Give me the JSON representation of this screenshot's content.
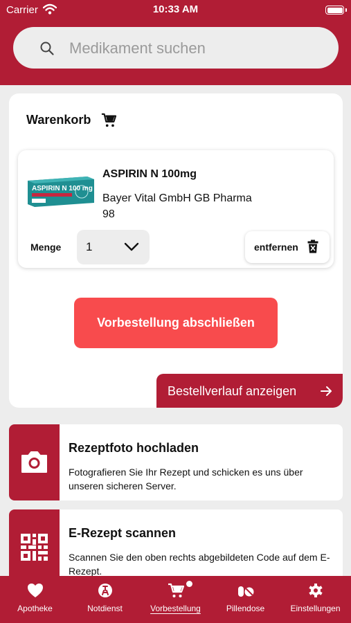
{
  "status_bar": {
    "carrier": "Carrier",
    "time": "10:33 AM"
  },
  "search": {
    "placeholder": "Medikament suchen",
    "icon": "search-icon"
  },
  "cart": {
    "title": "Warenkorb",
    "item": {
      "name": "ASPIRIN N 100mg",
      "manufacturer": "Bayer Vital GmbH GB Pharma",
      "number": "98",
      "package_text": "ASPIRIN N 100 mg",
      "quantity_label": "Menge",
      "quantity_value": "1",
      "remove_label": "entfernen"
    },
    "order_button": "Vorbestellung abschließen",
    "history_button": "Bestellverlauf anzeigen"
  },
  "features": [
    {
      "title": "Rezeptfoto hochladen",
      "description": "Fotografieren Sie Ihr Rezept und schicken es uns über unseren sicheren Server.",
      "icon": "camera-icon"
    },
    {
      "title": "E-Rezept scannen",
      "description": "Scannen Sie den oben rechts abgebildeten Code auf dem E-Rezept.",
      "icon": "qr-code-icon"
    }
  ],
  "tabs": [
    {
      "label": "Apotheke",
      "icon": "heart-icon",
      "active": false
    },
    {
      "label": "Notdienst",
      "icon": "emergency-icon",
      "active": false
    },
    {
      "label": "Vorbestellung",
      "icon": "cart-icon",
      "active": true
    },
    {
      "label": "Pillendose",
      "icon": "pills-icon",
      "active": false
    },
    {
      "label": "Einstellungen",
      "icon": "gear-icon",
      "active": false
    }
  ],
  "colors": {
    "brand": "#b11d35",
    "accent_button": "#f84b4d",
    "background": "#ededed"
  }
}
